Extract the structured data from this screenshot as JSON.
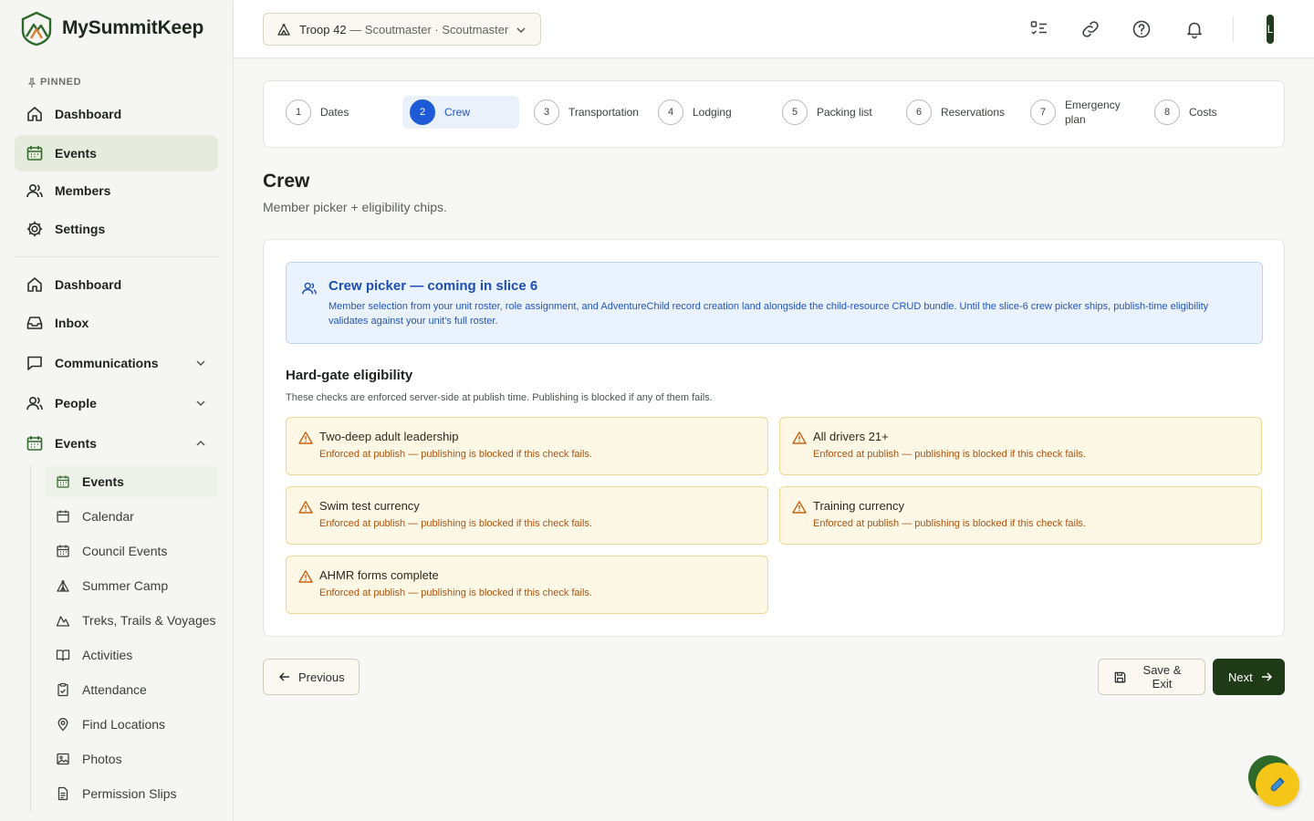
{
  "brand": {
    "name": "MySummitKeep",
    "icon": "mountain-logo-icon",
    "colors": {
      "green": "#2e6b2a",
      "orange": "#e0782a"
    }
  },
  "sidebar": {
    "pinned_label": "PINNED",
    "pinned": [
      {
        "label": "Dashboard",
        "icon": "home-icon"
      },
      {
        "label": "Events",
        "icon": "calendar-icon",
        "active": true
      },
      {
        "label": "Members",
        "icon": "users-icon"
      },
      {
        "label": "Settings",
        "icon": "gear-icon"
      }
    ],
    "main": [
      {
        "label": "Dashboard",
        "icon": "home-icon"
      },
      {
        "label": "Inbox",
        "icon": "inbox-icon"
      },
      {
        "label": "Communications",
        "icon": "message-icon",
        "expandable": true
      },
      {
        "label": "People",
        "icon": "users-icon",
        "expandable": true
      },
      {
        "label": "Events",
        "icon": "calendar-icon",
        "expanded": true
      }
    ],
    "events_sub": [
      {
        "label": "Events",
        "icon": "calendar-icon",
        "active": true
      },
      {
        "label": "Calendar",
        "icon": "calendar-icon"
      },
      {
        "label": "Council Events",
        "icon": "calendar-icon"
      },
      {
        "label": "Summer Camp",
        "icon": "tent-icon"
      },
      {
        "label": "Treks, Trails & Voyages",
        "icon": "mountain-icon"
      },
      {
        "label": "Activities",
        "icon": "book-icon"
      },
      {
        "label": "Attendance",
        "icon": "clipboard-icon"
      },
      {
        "label": "Find Locations",
        "icon": "map-pin-icon"
      },
      {
        "label": "Photos",
        "icon": "image-icon"
      },
      {
        "label": "Permission Slips",
        "icon": "file-icon"
      }
    ]
  },
  "topbar": {
    "troop_name": "Troop 42",
    "troop_role": "— Scoutmaster · Scoutmaster",
    "avatar_initial": "L"
  },
  "stepper": {
    "steps": [
      {
        "num": "1",
        "label": "Dates"
      },
      {
        "num": "2",
        "label": "Crew",
        "active": true
      },
      {
        "num": "3",
        "label": "Transportation"
      },
      {
        "num": "4",
        "label": "Lodging"
      },
      {
        "num": "5",
        "label": "Packing list"
      },
      {
        "num": "6",
        "label": "Reservations"
      },
      {
        "num": "7",
        "label": "Emergency plan"
      },
      {
        "num": "8",
        "label": "Costs"
      }
    ]
  },
  "page": {
    "title": "Crew",
    "subtitle": "Member picker + eligibility chips."
  },
  "info": {
    "title": "Crew picker — coming in slice 6",
    "text": "Member selection from your unit roster, role assignment, and AdventureChild record creation land alongside the child-resource CRUD bundle. Until the slice-6 crew picker ships, publish-time eligibility validates against your unit's full roster."
  },
  "eligibility": {
    "title": "Hard-gate eligibility",
    "description": "These checks are enforced server-side at publish time. Publishing is blocked if any of them fails.",
    "checks": [
      {
        "title": "Two-deep adult leadership",
        "text": "Enforced at publish — publishing is blocked if this check fails."
      },
      {
        "title": "All drivers 21+",
        "text": "Enforced at publish — publishing is blocked if this check fails."
      },
      {
        "title": "Swim test currency",
        "text": "Enforced at publish — publishing is blocked if this check fails."
      },
      {
        "title": "Training currency",
        "text": "Enforced at publish — publishing is blocked if this check fails."
      },
      {
        "title": "AHMR forms complete",
        "text": "Enforced at publish — publishing is blocked if this check fails."
      }
    ]
  },
  "footer": {
    "previous_label": "Previous",
    "save_label": "Save & Exit",
    "next_label": "Next"
  }
}
